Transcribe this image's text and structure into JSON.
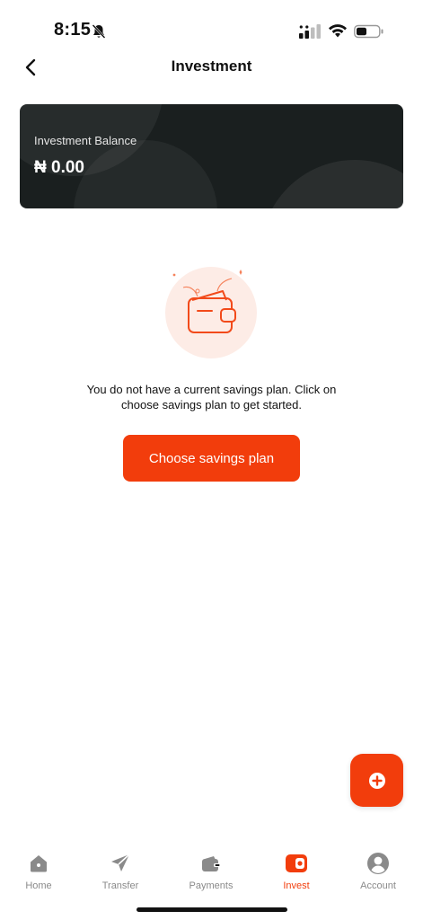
{
  "status_bar": {
    "time": "8:15"
  },
  "header": {
    "title": "Investment"
  },
  "balance_card": {
    "label": "Investment Balance",
    "value": "₦ 0.00"
  },
  "empty_state": {
    "message": "You do not have a current savings plan. Click on choose savings plan to get started."
  },
  "actions": {
    "choose_plan_label": "Choose savings plan"
  },
  "bottom_nav": {
    "items": [
      {
        "label": "Home",
        "icon": "home-icon"
      },
      {
        "label": "Transfer",
        "icon": "send-icon"
      },
      {
        "label": "Payments",
        "icon": "wallet-icon"
      },
      {
        "label": "Invest",
        "icon": "invest-icon",
        "active": true
      },
      {
        "label": "Account",
        "icon": "account-icon"
      }
    ]
  },
  "colors": {
    "accent": "#f23d0c",
    "card": "#1a1f1f",
    "inactive": "#8a8a8a"
  }
}
